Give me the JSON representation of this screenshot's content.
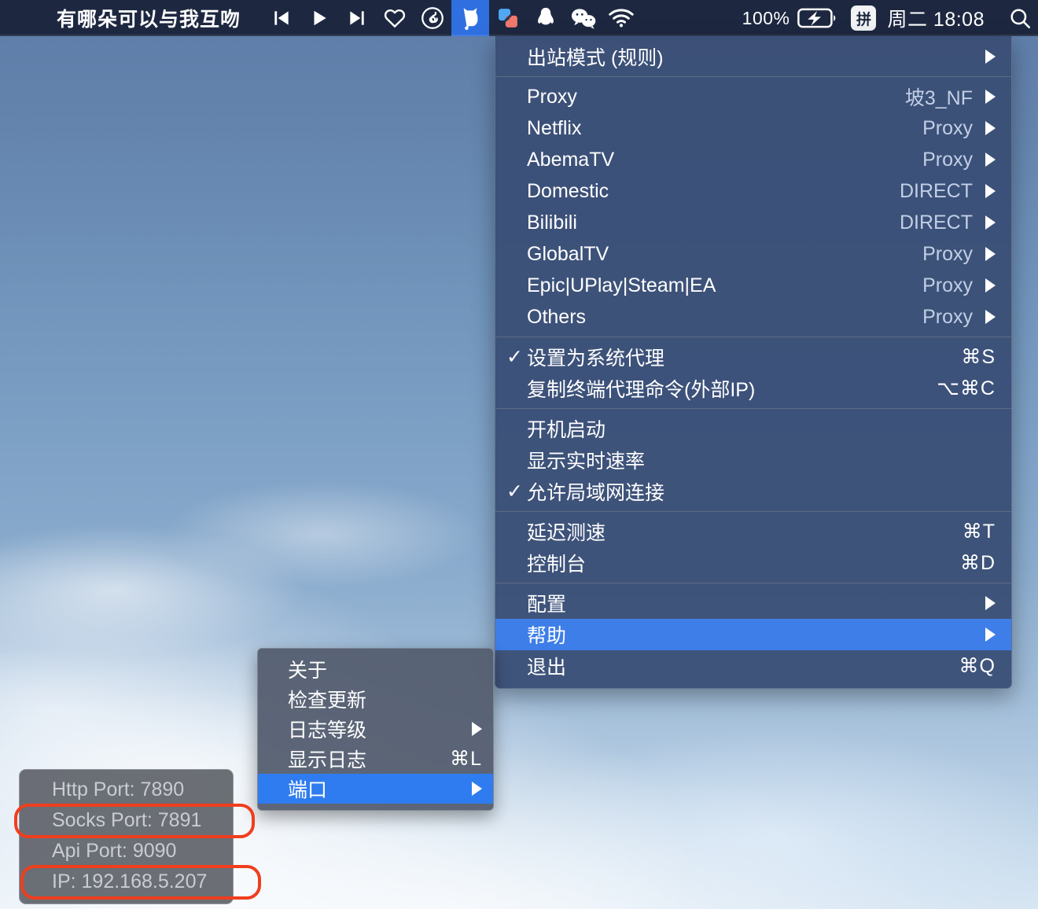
{
  "menubar": {
    "song_title": "有哪朵可以与我互吻",
    "media_prev_icon": "skip-previous-icon",
    "media_play_icon": "play-icon",
    "media_next_icon": "skip-next-icon",
    "favorite_icon": "heart-icon",
    "netease_icon": "netease-music-icon",
    "clashx_icon": "clashx-cat-icon",
    "snipaste_icon": "snipaste-icon",
    "qq_icon": "qq-penguin-icon",
    "wechat_icon": "wechat-icon",
    "wifi_icon": "wifi-icon",
    "battery_percent": "100%",
    "battery_icon": "battery-charging-icon",
    "ime_label": "拼",
    "clock": "周二 18:08",
    "search_icon": "search-icon",
    "accent_active": "#2f6fe0",
    "bar_bg": "#1d2840"
  },
  "main_menu": {
    "outbound_mode": {
      "label": "出站模式 (规则)",
      "arrow": true
    },
    "proxy_groups": [
      {
        "label": "Proxy",
        "value": "坡3_NF"
      },
      {
        "label": "Netflix",
        "value": "Proxy"
      },
      {
        "label": "AbemaTV",
        "value": "Proxy"
      },
      {
        "label": "Domestic",
        "value": "DIRECT"
      },
      {
        "label": "Bilibili",
        "value": "DIRECT"
      },
      {
        "label": "GlobalTV",
        "value": "Proxy"
      },
      {
        "label": "Epic|UPlay|Steam|EA",
        "value": "Proxy"
      },
      {
        "label": "Others",
        "value": "Proxy"
      }
    ],
    "system_section": [
      {
        "label": "设置为系统代理",
        "shortcut": "⌘S",
        "checked": true
      },
      {
        "label": "复制终端代理命令(外部IP)",
        "shortcut": "⌥⌘C",
        "checked": false
      }
    ],
    "options_section": [
      {
        "label": "开机启动",
        "checked": false
      },
      {
        "label": "显示实时速率",
        "checked": false
      },
      {
        "label": "允许局域网连接",
        "checked": true
      }
    ],
    "tools_section": [
      {
        "label": "延迟测速",
        "shortcut": "⌘T"
      },
      {
        "label": "控制台",
        "shortcut": "⌘D"
      }
    ],
    "bottom_section": [
      {
        "label": "配置",
        "arrow": true,
        "selected": false
      },
      {
        "label": "帮助",
        "arrow": true,
        "selected": true
      },
      {
        "label": "退出",
        "shortcut": "⌘Q",
        "selected": false
      }
    ],
    "check_glyph": "✓",
    "highlight_color": "#3d7ee8",
    "bg_color": "#394e75"
  },
  "help_submenu": {
    "items": [
      {
        "label": "关于",
        "shortcut": "",
        "arrow": false,
        "selected": false
      },
      {
        "label": "检查更新",
        "shortcut": "",
        "arrow": false,
        "selected": false
      },
      {
        "label": "日志等级",
        "shortcut": "",
        "arrow": true,
        "selected": false
      },
      {
        "label": "显示日志",
        "shortcut": "⌘L",
        "arrow": false,
        "selected": false
      },
      {
        "label": "端口",
        "shortcut": "",
        "arrow": true,
        "selected": true
      }
    ],
    "highlight_color": "#2f7cf0"
  },
  "port_panel": {
    "rows": [
      "Http Port: 7890",
      "Socks Port: 7891",
      "Api Port: 9090",
      "IP: 192.168.5.207"
    ]
  },
  "annotations": {
    "color": "#f03e1e",
    "boxes": [
      {
        "name": "socks-port-highlight"
      },
      {
        "name": "ip-address-highlight"
      }
    ]
  }
}
